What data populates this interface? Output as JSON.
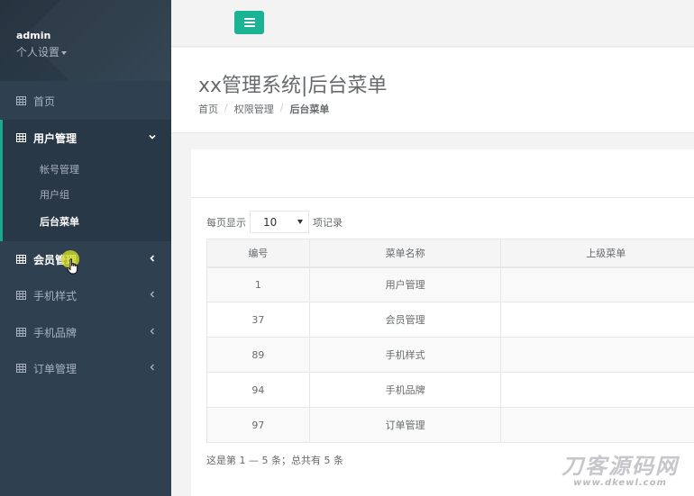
{
  "sidebar": {
    "username": "admin",
    "settings_label": "个人设置",
    "items": [
      {
        "label": "首页"
      },
      {
        "label": "用户管理"
      },
      {
        "label": "会员管理"
      },
      {
        "label": "手机样式"
      },
      {
        "label": "手机品牌"
      },
      {
        "label": "订单管理"
      }
    ],
    "submenu": [
      {
        "label": "帐号管理"
      },
      {
        "label": "用户组"
      },
      {
        "label": "后台菜单"
      }
    ]
  },
  "header": {
    "title": "xx管理系统|后台菜单",
    "breadcrumb": [
      "首页",
      "权限管理",
      "后台菜单"
    ]
  },
  "table_controls": {
    "show_prefix": "每页显示",
    "page_size": "10",
    "show_suffix": "项记录"
  },
  "table": {
    "columns": [
      "编号",
      "菜单名称",
      "上级菜单"
    ],
    "rows": [
      {
        "id": "1",
        "name": "用户管理",
        "parent": ""
      },
      {
        "id": "37",
        "name": "会员管理",
        "parent": ""
      },
      {
        "id": "89",
        "name": "手机样式",
        "parent": ""
      },
      {
        "id": "94",
        "name": "手机品牌",
        "parent": ""
      },
      {
        "id": "97",
        "name": "订单管理",
        "parent": ""
      }
    ],
    "info": "这是第 1 — 5 条；总共有 5 条"
  },
  "watermark": {
    "name": "刀客源码网",
    "url": "www.dkewl.com"
  },
  "colors": {
    "sidebar_bg": "#2f4050",
    "accent": "#1ab394",
    "text": "#676a6c"
  }
}
